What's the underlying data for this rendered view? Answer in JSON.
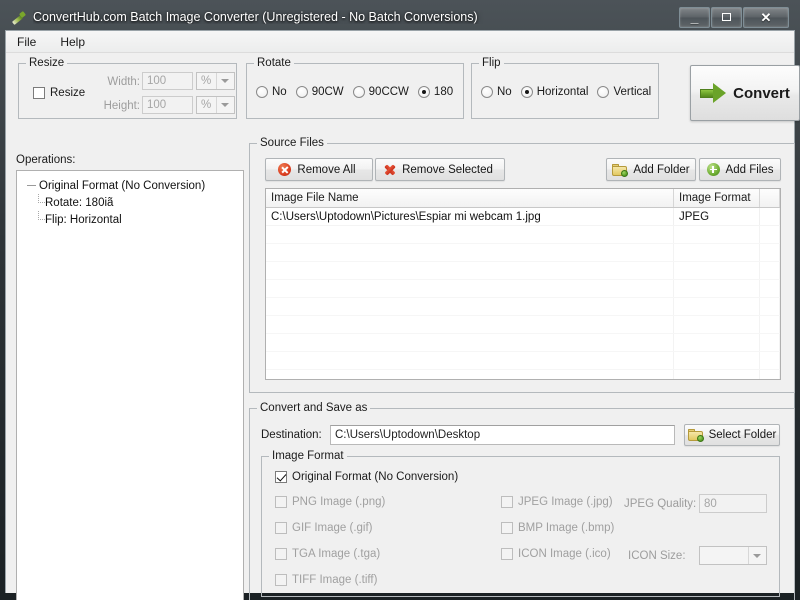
{
  "window": {
    "title": "ConvertHub.com Batch Image Converter (Unregistered - No Batch Conversions)",
    "icon": "paintbrush-icon",
    "minimize_label": "—",
    "maximize_label": "",
    "close_label": "✕"
  },
  "menubar": {
    "items": [
      {
        "label": "File"
      },
      {
        "label": "Help"
      }
    ]
  },
  "resize": {
    "legend": "Resize",
    "enable_label": "Resize",
    "enabled": false,
    "width_label": "Width:",
    "width_value": "100",
    "width_unit": "%",
    "height_label": "Height:",
    "height_value": "100",
    "height_unit": "%"
  },
  "rotate": {
    "legend": "Rotate",
    "options": [
      {
        "label": "No",
        "selected": false
      },
      {
        "label": "90CW",
        "selected": false
      },
      {
        "label": "90CCW",
        "selected": false
      },
      {
        "label": "180",
        "selected": true
      }
    ]
  },
  "flip": {
    "legend": "Flip",
    "options": [
      {
        "label": "No",
        "selected": false
      },
      {
        "label": "Horizontal",
        "selected": true
      },
      {
        "label": "Vertical",
        "selected": false
      }
    ]
  },
  "convert_button": {
    "label": "Convert",
    "icon": "green-arrow-right-icon"
  },
  "operations": {
    "label": "Operations:",
    "root": "Original Format (No Conversion)",
    "children": [
      "Rotate: 180iã",
      "Flip: Horizontal"
    ]
  },
  "source_files": {
    "legend": "Source Files",
    "buttons": {
      "remove_all": "Remove All",
      "remove_selected": "Remove Selected",
      "add_folder": "Add Folder",
      "add_files": "Add Files"
    },
    "columns": [
      "Image File Name",
      "Image Format"
    ],
    "rows": [
      {
        "name": "C:\\Users\\Uptodown\\Pictures\\Espiar mi webcam 1.jpg",
        "format": "JPEG"
      }
    ]
  },
  "convert_save": {
    "legend": "Convert and Save as",
    "destination_label": "Destination:",
    "destination_value": "C:\\Users\\Uptodown\\Desktop",
    "select_folder_label": "Select Folder",
    "image_format": {
      "legend": "Image Format",
      "original": {
        "label": "Original Format (No Conversion)",
        "checked": true,
        "enabled": true
      },
      "options": [
        {
          "label": "PNG Image (.png)",
          "checked": false,
          "enabled": false
        },
        {
          "label": "JPEG Image (.jpg)",
          "checked": false,
          "enabled": false
        },
        {
          "label": "GIF Image (.gif)",
          "checked": false,
          "enabled": false
        },
        {
          "label": "BMP Image (.bmp)",
          "checked": false,
          "enabled": false
        },
        {
          "label": "TGA Image (.tga)",
          "checked": false,
          "enabled": false
        },
        {
          "label": "ICON Image (.ico)",
          "checked": false,
          "enabled": false
        },
        {
          "label": "TIFF Image (.tiff)",
          "checked": false,
          "enabled": false
        }
      ],
      "jpeg_quality_label": "JPEG Quality:",
      "jpeg_quality_value": "80",
      "icon_size_label": "ICON Size:",
      "icon_size_value": ""
    }
  },
  "colors": {
    "accent_green": "#6aa329",
    "remove_red": "#d93a1d",
    "window_face": "#f0f0f0",
    "titlebar_dark": "#2e3438"
  }
}
